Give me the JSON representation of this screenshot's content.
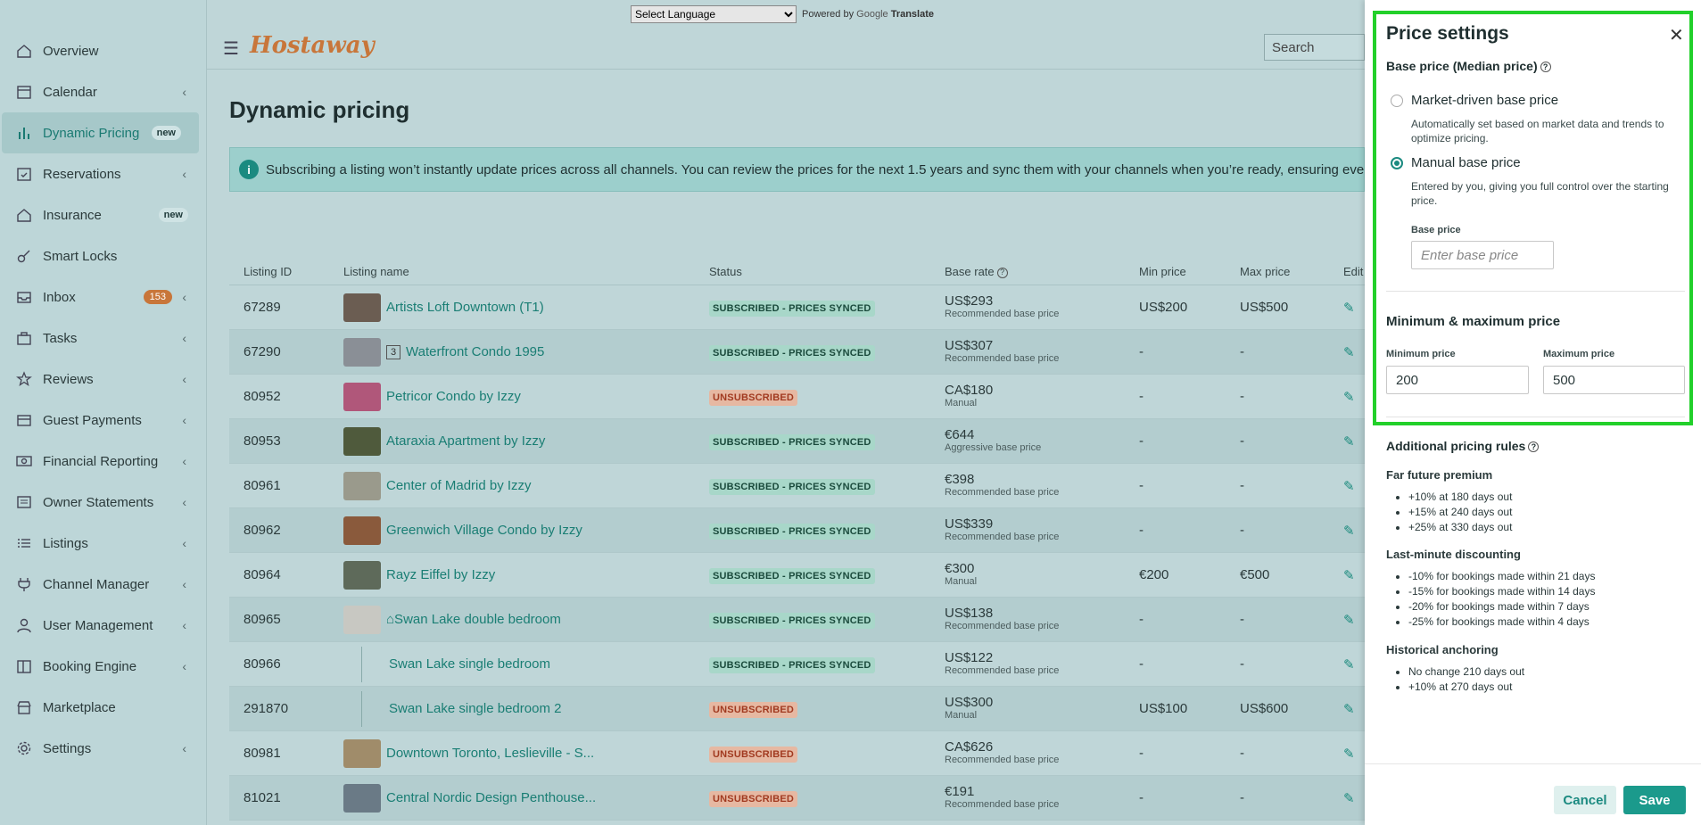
{
  "topbar": {
    "language_select": "Select Language",
    "powered_by": "Powered by",
    "google": "Google",
    "translate": "Translate",
    "logo": "Hostaway",
    "search_placeholder": "Search"
  },
  "sidebar": {
    "items": [
      {
        "label": "Overview",
        "icon": "home-icon"
      },
      {
        "label": "Calendar",
        "icon": "calendar-icon",
        "chevron": true
      },
      {
        "label": "Dynamic Pricing",
        "icon": "bar-chart-icon",
        "badge": "new",
        "active": true
      },
      {
        "label": "Reservations",
        "icon": "reservation-icon",
        "chevron": true
      },
      {
        "label": "Insurance",
        "icon": "home-icon",
        "badge": "new"
      },
      {
        "label": "Smart Locks",
        "icon": "key-icon"
      },
      {
        "label": "Inbox",
        "icon": "inbox-icon",
        "count": "153",
        "chevron": true
      },
      {
        "label": "Tasks",
        "icon": "toolbox-icon",
        "chevron": true
      },
      {
        "label": "Reviews",
        "icon": "star-icon",
        "chevron": true
      },
      {
        "label": "Guest Payments",
        "icon": "card-icon",
        "chevron": true
      },
      {
        "label": "Financial Reporting",
        "icon": "money-icon",
        "chevron": true
      },
      {
        "label": "Owner Statements",
        "icon": "statement-icon",
        "chevron": true
      },
      {
        "label": "Listings",
        "icon": "list-icon",
        "chevron": true
      },
      {
        "label": "Channel Manager",
        "icon": "plug-icon",
        "chevron": true
      },
      {
        "label": "User Management",
        "icon": "user-icon",
        "chevron": true
      },
      {
        "label": "Booking Engine",
        "icon": "layout-icon",
        "chevron": true
      },
      {
        "label": "Marketplace",
        "icon": "marketplace-icon"
      },
      {
        "label": "Settings",
        "icon": "gear-icon",
        "chevron": true
      }
    ]
  },
  "main": {
    "title": "Dynamic pricing",
    "banner": "Subscribing a listing won’t instantly update prices across all channels. You can review the prices for the next 1.5 years and sync them with your channels when you’re ready, ensuring everythin",
    "columns": [
      "Listing ID",
      "Listing name",
      "Status",
      "Base rate",
      "Min price",
      "Max price",
      "Edit"
    ],
    "rows": [
      {
        "id": "67289",
        "name": "Artists Loft Downtown (T1)",
        "status": "SUBSCRIBED - PRICES SYNCED",
        "rate": "US$293",
        "rate_note": "Recommended base price",
        "min": "US$200",
        "max": "US$500",
        "thumb": "#6b5d52"
      },
      {
        "id": "67290",
        "name": "Waterfront Condo 1995",
        "tag": "3",
        "status": "SUBSCRIBED - PRICES SYNCED",
        "rate": "US$307",
        "rate_note": "Recommended base price",
        "min": "-",
        "max": "-",
        "thumb": "#8a8f96"
      },
      {
        "id": "80952",
        "name": "Petricor Condo by Izzy",
        "status": "UNSUBSCRIBED",
        "rate": "CA$180",
        "rate_note": "Manual",
        "min": "-",
        "max": "-",
        "thumb": "#b0577a"
      },
      {
        "id": "80953",
        "name": "Ataraxia Apartment by Izzy",
        "status": "SUBSCRIBED - PRICES SYNCED",
        "rate": "€644",
        "rate_note": "Aggressive base price",
        "min": "-",
        "max": "-",
        "thumb": "#4f5a3c"
      },
      {
        "id": "80961",
        "name": "Center of Madrid by Izzy",
        "status": "SUBSCRIBED - PRICES SYNCED",
        "rate": "€398",
        "rate_note": "Recommended base price",
        "min": "-",
        "max": "-",
        "thumb": "#9a9a8c"
      },
      {
        "id": "80962",
        "name": "Greenwich Village Condo by Izzy",
        "status": "SUBSCRIBED - PRICES SYNCED",
        "rate": "US$339",
        "rate_note": "Recommended base price",
        "min": "-",
        "max": "-",
        "thumb": "#8a5a3c"
      },
      {
        "id": "80964",
        "name": "Rayz Eiffel by Izzy",
        "status": "SUBSCRIBED - PRICES SYNCED",
        "rate": "€300",
        "rate_note": "Manual",
        "min": "€200",
        "max": "€500",
        "thumb": "#5e6a5a"
      },
      {
        "id": "80965",
        "name": "⌂Swan Lake double bedroom",
        "status": "SUBSCRIBED - PRICES SYNCED",
        "rate": "US$138",
        "rate_note": "Recommended base price",
        "min": "-",
        "max": "-",
        "thumb": "#c8c8c2"
      },
      {
        "id": "80966",
        "name": "Swan Lake single bedroom",
        "child": true,
        "status": "SUBSCRIBED - PRICES SYNCED",
        "rate": "US$122",
        "rate_note": "Recommended base price",
        "min": "-",
        "max": "-"
      },
      {
        "id": "291870",
        "name": "Swan Lake single bedroom 2",
        "child": true,
        "status": "UNSUBSCRIBED",
        "rate": "US$300",
        "rate_note": "Manual",
        "min": "US$100",
        "max": "US$600"
      },
      {
        "id": "80981",
        "name": "Downtown Toronto, Leslieville - S...",
        "status": "UNSUBSCRIBED",
        "rate": "CA$626",
        "rate_note": "Recommended base price",
        "min": "-",
        "max": "-",
        "thumb": "#a08c6a"
      },
      {
        "id": "81021",
        "name": "Central Nordic Design Penthouse...",
        "status": "UNSUBSCRIBED",
        "rate": "€191",
        "rate_note": "Recommended base price",
        "min": "-",
        "max": "-",
        "thumb": "#6a7a86"
      }
    ]
  },
  "panel": {
    "title": "Price settings",
    "base_heading": "Base price (Median price)",
    "market_label": "Market-driven base price",
    "market_desc": "Automatically set based on market data and trends to optimize pricing.",
    "manual_label": "Manual base price",
    "manual_desc": "Entered by you, giving you full control over the starting price.",
    "base_price_label": "Base price",
    "base_price_placeholder": "Enter base price",
    "minmax_heading": "Minimum & maximum price",
    "min_label": "Minimum price",
    "min_value": "200",
    "max_label": "Maximum price",
    "max_value": "500",
    "rules_heading": "Additional pricing rules",
    "far_future_title": "Far future premium",
    "far_future": [
      "+10% at 180 days out",
      "+15% at 240 days out",
      "+25% at 330 days out"
    ],
    "last_minute_title": "Last-minute discounting",
    "last_minute": [
      "-10% for bookings made within 21 days",
      "-15% for bookings made within 14 days",
      "-20% for bookings made within 7 days",
      "-25% for bookings made within 4 days"
    ],
    "historical_title": "Historical anchoring",
    "historical": [
      "No change 210 days out",
      "+10% at 270 days out"
    ],
    "cancel": "Cancel",
    "save": "Save"
  }
}
